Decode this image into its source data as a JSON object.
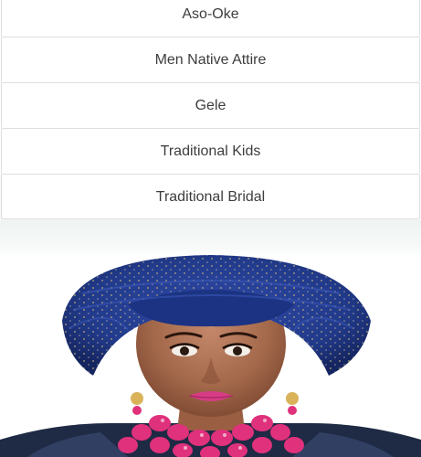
{
  "menu": {
    "items": [
      {
        "label": "Aso-Oke"
      },
      {
        "label": "Men Native Attire"
      },
      {
        "label": "Gele"
      },
      {
        "label": "Traditional Kids"
      },
      {
        "label": "Traditional Bridal"
      }
    ]
  },
  "hero": {
    "subject": "woman-in-blue-gele-photo",
    "colors": {
      "gele": "#243c8c",
      "skin": "#a3684a",
      "lips": "#d63c85",
      "beads": "#e0317c",
      "outfit": "#1f2a44"
    }
  }
}
